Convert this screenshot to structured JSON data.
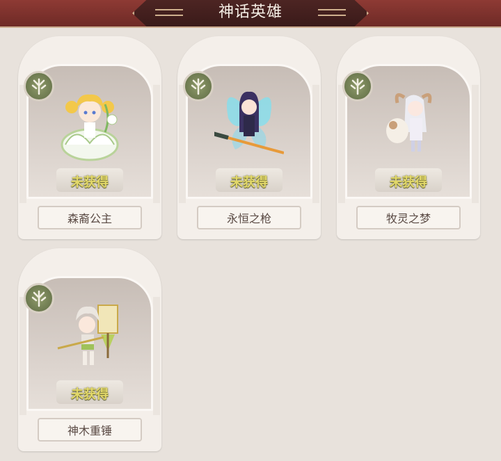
{
  "header": {
    "title": "神话英雄"
  },
  "status_label": "未获得",
  "heroes": [
    {
      "name": "森裔公主",
      "icon": "flower-fairy-sprite"
    },
    {
      "name": "永恒之枪",
      "icon": "butterfly-spear-sprite"
    },
    {
      "name": "牧灵之梦",
      "icon": "sheep-girl-sprite"
    },
    {
      "name": "神木重锤",
      "icon": "hammer-girl-sprite"
    }
  ],
  "colors": {
    "header_bg": "#7e322d",
    "status_text": "#e2d86a",
    "emblem": "#6f7b50"
  }
}
